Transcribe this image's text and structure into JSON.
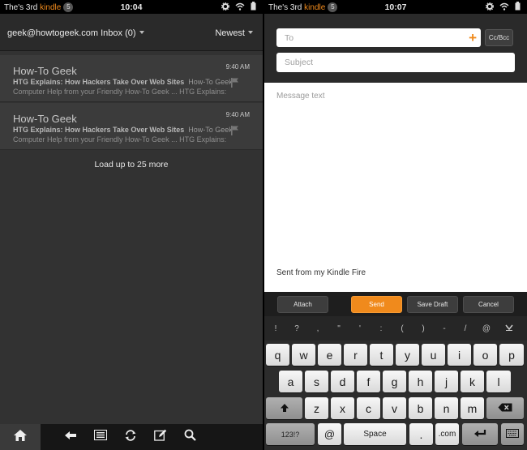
{
  "left": {
    "status": {
      "owner_prefix": "The's 3rd ",
      "brand": "kindle",
      "notif_count": "5",
      "clock": "10:04"
    },
    "header": {
      "inbox_label": "geek@howtogeek.com Inbox (0)",
      "sort_label": "Newest"
    },
    "messages": [
      {
        "sender": "How-To Geek",
        "subject": "HTG Explains: How Hackers Take Over Web Sites",
        "snippet_tail": "How-To Geek",
        "snippet2": "Computer Help from your Friendly How-To Geek ... HTG Explains:",
        "time": "9:40 AM"
      },
      {
        "sender": "How-To Geek",
        "subject": "HTG Explains: How Hackers Take Over Web Sites",
        "snippet_tail": "How-To Geek",
        "snippet2": "Computer Help from your Friendly How-To Geek ... HTG Explains:",
        "time": "9:40 AM"
      }
    ],
    "load_more": "Load up to 25 more"
  },
  "right": {
    "status": {
      "owner_prefix": "The's 3rd ",
      "brand": "kindle",
      "notif_count": "5",
      "clock": "10:07"
    },
    "to_placeholder": "To",
    "plus": "+",
    "ccbcc": "Cc/Bcc",
    "subject_placeholder": "Subject",
    "body_placeholder": "Message text",
    "signature": "Sent from my Kindle Fire",
    "actions": {
      "attach": "Attach",
      "send": "Send",
      "save_draft": "Save Draft",
      "cancel": "Cancel"
    },
    "keyboard": {
      "symbols": [
        "!",
        "?",
        ",",
        "\"",
        "'",
        ":",
        "(",
        ")",
        "-",
        "/",
        "@"
      ],
      "row1": [
        "q",
        "w",
        "e",
        "r",
        "t",
        "y",
        "u",
        "i",
        "o",
        "p"
      ],
      "row2": [
        "a",
        "s",
        "d",
        "f",
        "g",
        "h",
        "j",
        "k",
        "l"
      ],
      "row3": [
        "z",
        "x",
        "c",
        "v",
        "b",
        "n",
        "m"
      ],
      "numbers_label": "123!?",
      "at": "@",
      "space": "Space",
      "dot": ".",
      "dotcom": ".com"
    }
  },
  "colors": {
    "accent": "#f08a1c"
  }
}
